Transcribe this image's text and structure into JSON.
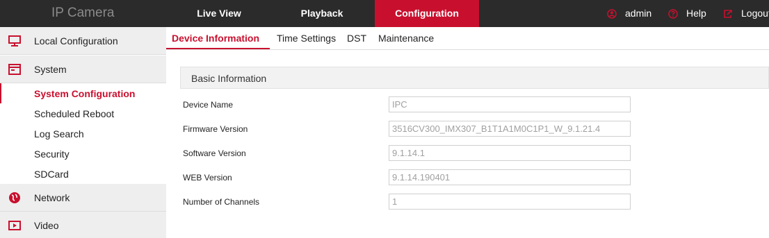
{
  "header": {
    "brand": "IP Camera",
    "nav": [
      {
        "label": "Live View"
      },
      {
        "label": "Playback"
      },
      {
        "label": "Configuration"
      }
    ],
    "active_nav": "Configuration",
    "user": {
      "label": "admin",
      "icon": "user-icon"
    },
    "help": {
      "label": "Help",
      "icon": "help-icon"
    },
    "logout": {
      "label": "Logout",
      "icon": "logout-icon"
    }
  },
  "sidebar": {
    "items": [
      {
        "label": "Local Configuration",
        "icon": "monitor-icon"
      },
      {
        "label": "System",
        "icon": "system-window-icon"
      },
      {
        "label": "Network",
        "icon": "network-globe-icon"
      },
      {
        "label": "Video",
        "icon": "video-icon"
      }
    ],
    "system_sub": [
      {
        "label": "System Configuration"
      },
      {
        "label": "Scheduled Reboot"
      },
      {
        "label": "Log Search"
      },
      {
        "label": "Security"
      },
      {
        "label": "SDCard"
      }
    ],
    "active_sub": "System Configuration"
  },
  "tabs": [
    {
      "label": "Device Information"
    },
    {
      "label": "Time Settings"
    },
    {
      "label": "DST"
    },
    {
      "label": "Maintenance"
    }
  ],
  "active_tab": "Device Information",
  "section": {
    "title": "Basic Information"
  },
  "fields": [
    {
      "label": "Device Name",
      "value": "IPC"
    },
    {
      "label": "Firmware Version",
      "value": "3516CV300_IMX307_B1T1A1M0C1P1_W_9.1.21.4"
    },
    {
      "label": "Software Version",
      "value": "9.1.14.1"
    },
    {
      "label": "WEB Version",
      "value": "9.1.14.190401"
    },
    {
      "label": "Number of Channels",
      "value": "1"
    }
  ],
  "colors": {
    "accent": "#c8102e",
    "topbar": "#2b2b2b",
    "sidebar_bg": "#eeeeee"
  }
}
